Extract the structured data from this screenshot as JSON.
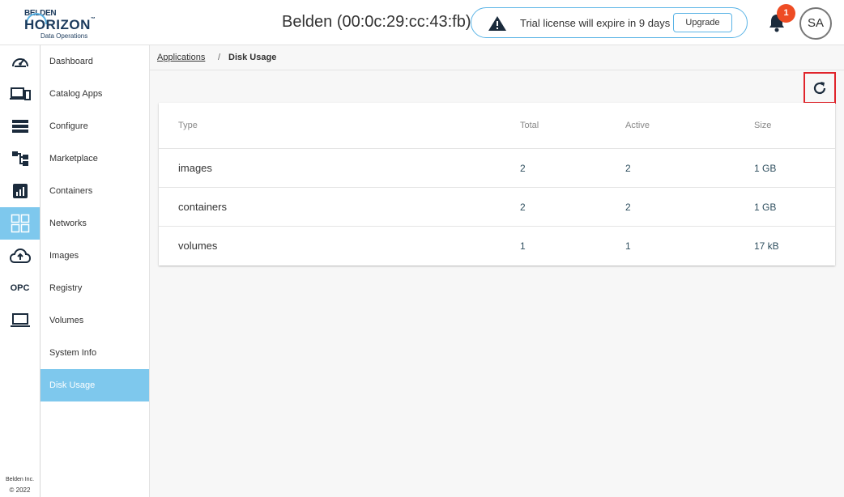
{
  "header": {
    "logo": {
      "top": "BELDEN",
      "main": "HORIZON",
      "tm": "™",
      "sub": "Data Operations"
    },
    "device_title": "Belden (00:0c:29:cc:43:fb)",
    "license_message": "Trial license will expire in 9 days",
    "upgrade_label": "Upgrade",
    "notification_count": "1",
    "avatar_initials": "SA"
  },
  "rail": {
    "opc_label": "OPC",
    "footer_company": "Belden Inc.",
    "footer_year": "© 2022"
  },
  "sidebar": {
    "items": [
      {
        "label": "Dashboard",
        "icon": "speedometer-icon"
      },
      {
        "label": "Catalog Apps",
        "icon": "devices-icon"
      },
      {
        "label": "Configure",
        "icon": "list-icon"
      },
      {
        "label": "Marketplace",
        "icon": "hierarchy-icon"
      },
      {
        "label": "Containers",
        "icon": "chart-icon"
      },
      {
        "label": "Networks",
        "icon": "apps-grid-icon"
      },
      {
        "label": "Images",
        "icon": "cloud-upload-icon"
      },
      {
        "label": "Registry",
        "icon": "opc-icon"
      },
      {
        "label": "Volumes",
        "icon": "laptop-icon"
      },
      {
        "label": "System Info"
      },
      {
        "label": "Disk Usage"
      }
    ],
    "active_item": "Disk Usage"
  },
  "breadcrumb": {
    "parent": "Applications",
    "separator": "/",
    "current": "Disk Usage"
  },
  "table": {
    "columns": [
      "Type",
      "Total",
      "Active",
      "Size"
    ],
    "rows": [
      {
        "type": "images",
        "total": "2",
        "active": "2",
        "size": "1 GB"
      },
      {
        "type": "containers",
        "total": "2",
        "active": "2",
        "size": "1 GB"
      },
      {
        "type": "volumes",
        "total": "1",
        "active": "1",
        "size": "17 kB"
      }
    ]
  },
  "colors": {
    "accent": "#7ec8ed",
    "brand": "#1b3a5c",
    "badge": "#ee4c24",
    "highlight_border": "#e0242b"
  }
}
